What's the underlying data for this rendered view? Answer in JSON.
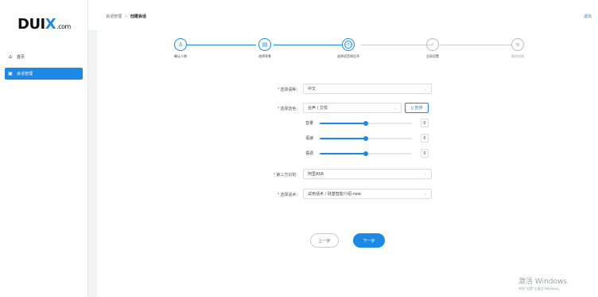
{
  "brand": {
    "logo_main": "DUI",
    "logo_x": "X",
    "logo_suffix": ".com",
    "accent": "#1e88e5"
  },
  "sidebar": {
    "items": [
      {
        "icon": "⌂",
        "label": "首页"
      },
      {
        "icon": "▣",
        "label": "会话管理"
      }
    ]
  },
  "header": {
    "breadcrumb": [
      "会话管理",
      "创建会话"
    ],
    "breadcrumb_sep": "/",
    "logout": "退出"
  },
  "steps": [
    {
      "label": "确认人物",
      "state": "done",
      "icon": "♙"
    },
    {
      "label": "选择背景",
      "state": "done",
      "icon": "▤"
    },
    {
      "label": "选择语音和话术",
      "state": "active",
      "icon": "◁▷"
    },
    {
      "label": "全局设置",
      "state": "todo",
      "icon": "✓"
    },
    {
      "label": "最终创建",
      "state": "todo",
      "icon": "≡"
    }
  ],
  "form": {
    "language": {
      "label": "选择语种:",
      "value": "中文"
    },
    "voice": {
      "label": "选择音色:",
      "value": "台声 / 艾悦",
      "pause_button": "|| 暂停"
    },
    "sliders": [
      {
        "label": "音量",
        "value": 0.5,
        "display": "0"
      },
      {
        "label": "语速",
        "value": 0.5,
        "display": "0"
      },
      {
        "label": "语调",
        "value": 0.5,
        "display": "0"
      }
    ],
    "asr": {
      "label": "第三方识别:",
      "value": "阿里ASR"
    },
    "script": {
      "label": "选择话术:",
      "value": "试用话术 / 硅基智能介绍-new"
    }
  },
  "actions": {
    "prev": "上一步",
    "next": "下一步"
  },
  "watermark": {
    "line1": "激活 Windows",
    "line2": "转到\"设置\"以激活 Windows。"
  }
}
